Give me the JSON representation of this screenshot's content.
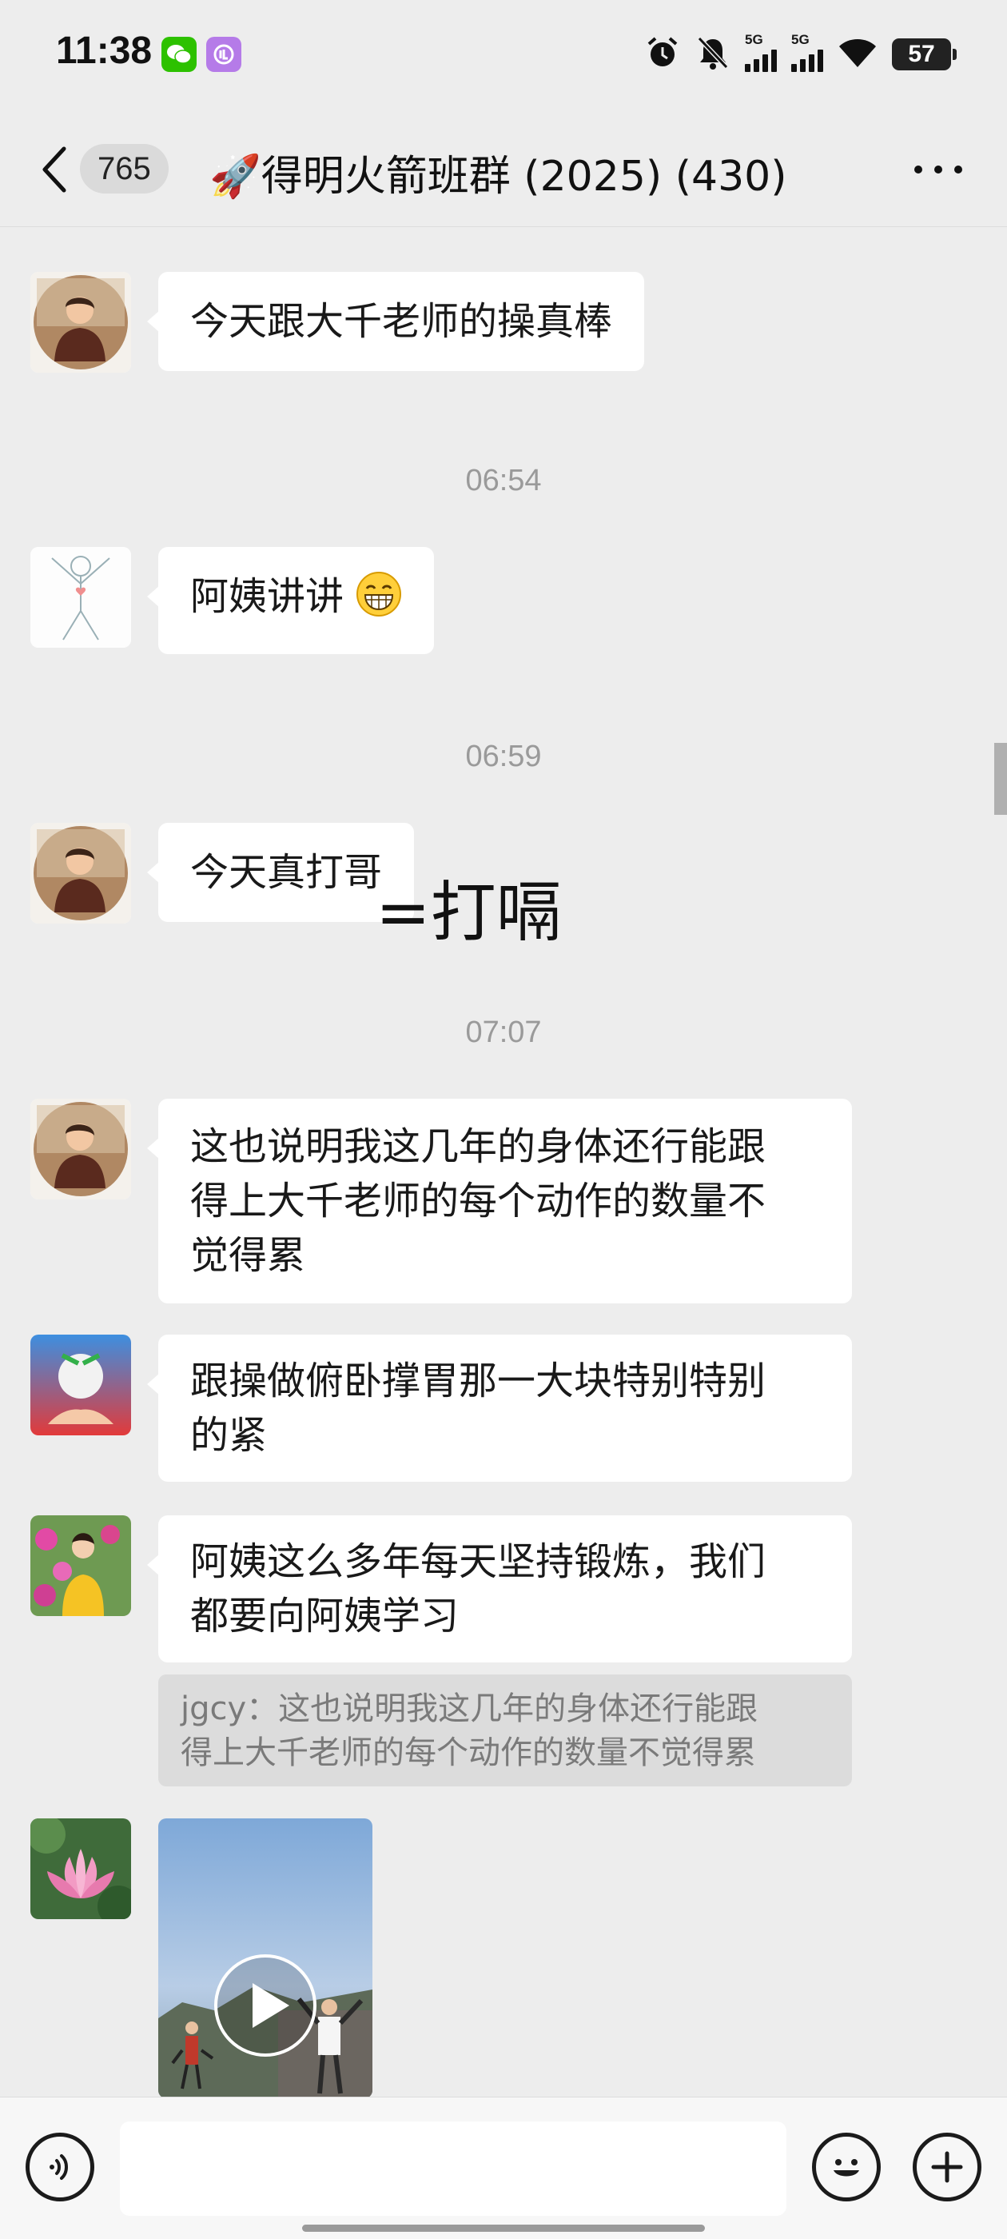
{
  "status_bar": {
    "time": "11:38",
    "apps": [
      "wechat-icon",
      "app-icon"
    ],
    "network_1": "5G",
    "network_2": "5G",
    "battery": "57"
  },
  "header": {
    "back_icon": "chevron-left-icon",
    "unread_count": "765",
    "title": "🚀得明火箭班群 (2025) (430)",
    "more_icon": "more-dots-icon"
  },
  "messages": [
    {
      "type": "text",
      "text": "今天跟大千老师的操真棒"
    },
    {
      "type": "time",
      "text": "06:54"
    },
    {
      "type": "text",
      "text": "阿姨讲讲",
      "emoji": "grin-emoji"
    },
    {
      "type": "time",
      "text": "06:59"
    },
    {
      "type": "text",
      "text": "今天真打哥"
    },
    {
      "type": "time",
      "text": "07:07"
    },
    {
      "type": "text",
      "lines": [
        "这也说明我这几年的身体还行能跟",
        "得上大千老师的每个动作的数量不",
        "觉得累"
      ]
    },
    {
      "type": "text",
      "lines": [
        "跟操做俯卧撑胃那一大块特别特别",
        "的紧"
      ]
    },
    {
      "type": "text",
      "lines": [
        "阿姨这么多年每天坚持锻炼，我们",
        "都要向阿姨学习"
      ]
    },
    {
      "type": "quote",
      "lines": [
        "jgcy：这也说明我这几年的身体还行能跟",
        "得上大千老师的每个动作的数量不觉得累"
      ]
    },
    {
      "type": "video",
      "icon": "play-icon"
    }
  ],
  "overlay_annotation": "=打嗝",
  "input_bar": {
    "voice_icon": "voice-icon",
    "emoji_icon": "emoji-icon",
    "plus_icon": "plus-icon",
    "placeholder": ""
  },
  "colors": {
    "background": "#ededed",
    "bubble": "#ffffff",
    "timestamp": "#9a9a9a",
    "quote_bg": "#dcdcdc"
  }
}
